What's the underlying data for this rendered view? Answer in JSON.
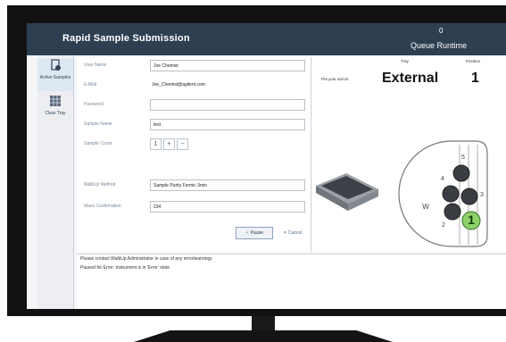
{
  "app": {
    "title": "Rapid Sample Submission",
    "queue_count": "0",
    "queue_label": "Queue Runtime"
  },
  "sidebar": {
    "items": [
      {
        "label": "Active Samples",
        "icon": "samples-icon"
      },
      {
        "label": "Clear Tray",
        "icon": "tray-icon"
      }
    ]
  },
  "form": {
    "user_name": {
      "label": "User Name",
      "value": "Joe Chemist"
    },
    "email": {
      "label": "E-Mail",
      "value": "Joe_Chemist@agilent.com"
    },
    "password": {
      "label": "Password",
      "value": ""
    },
    "sample_name": {
      "label": "Sample Name",
      "value": "test"
    },
    "sample_count": {
      "label": "Sample Count",
      "value": "1",
      "plus": "+",
      "minus": "−"
    },
    "method": {
      "label": "WalkUp Method",
      "value": "Sample Purity Formic 3min"
    },
    "mass": {
      "label": "Mass Confirmation",
      "value": "234"
    },
    "pause_label": "Pause",
    "cancel_label": "Cancel"
  },
  "tray": {
    "tray_header": "Tray",
    "position_header": "Position",
    "vial_prompt": "Put your vial at:",
    "tray_name": "External",
    "position": "1",
    "positions": [
      {
        "label": "1",
        "state": "available"
      },
      {
        "label": "2",
        "state": "occupied"
      },
      {
        "label": "3",
        "state": "occupied"
      },
      {
        "label": "4",
        "state": "occupied"
      },
      {
        "label": "5",
        "state": "occupied"
      },
      {
        "label": "W",
        "state": "waste"
      }
    ],
    "colors": {
      "available": "#8fd06a",
      "occupied": "#3a3d42"
    }
  },
  "footer": {
    "line1": "Please contact WalkUp Administrator in case of any error/warnings",
    "line2": "Paused for Error: Instrument is in 'Error' state"
  }
}
